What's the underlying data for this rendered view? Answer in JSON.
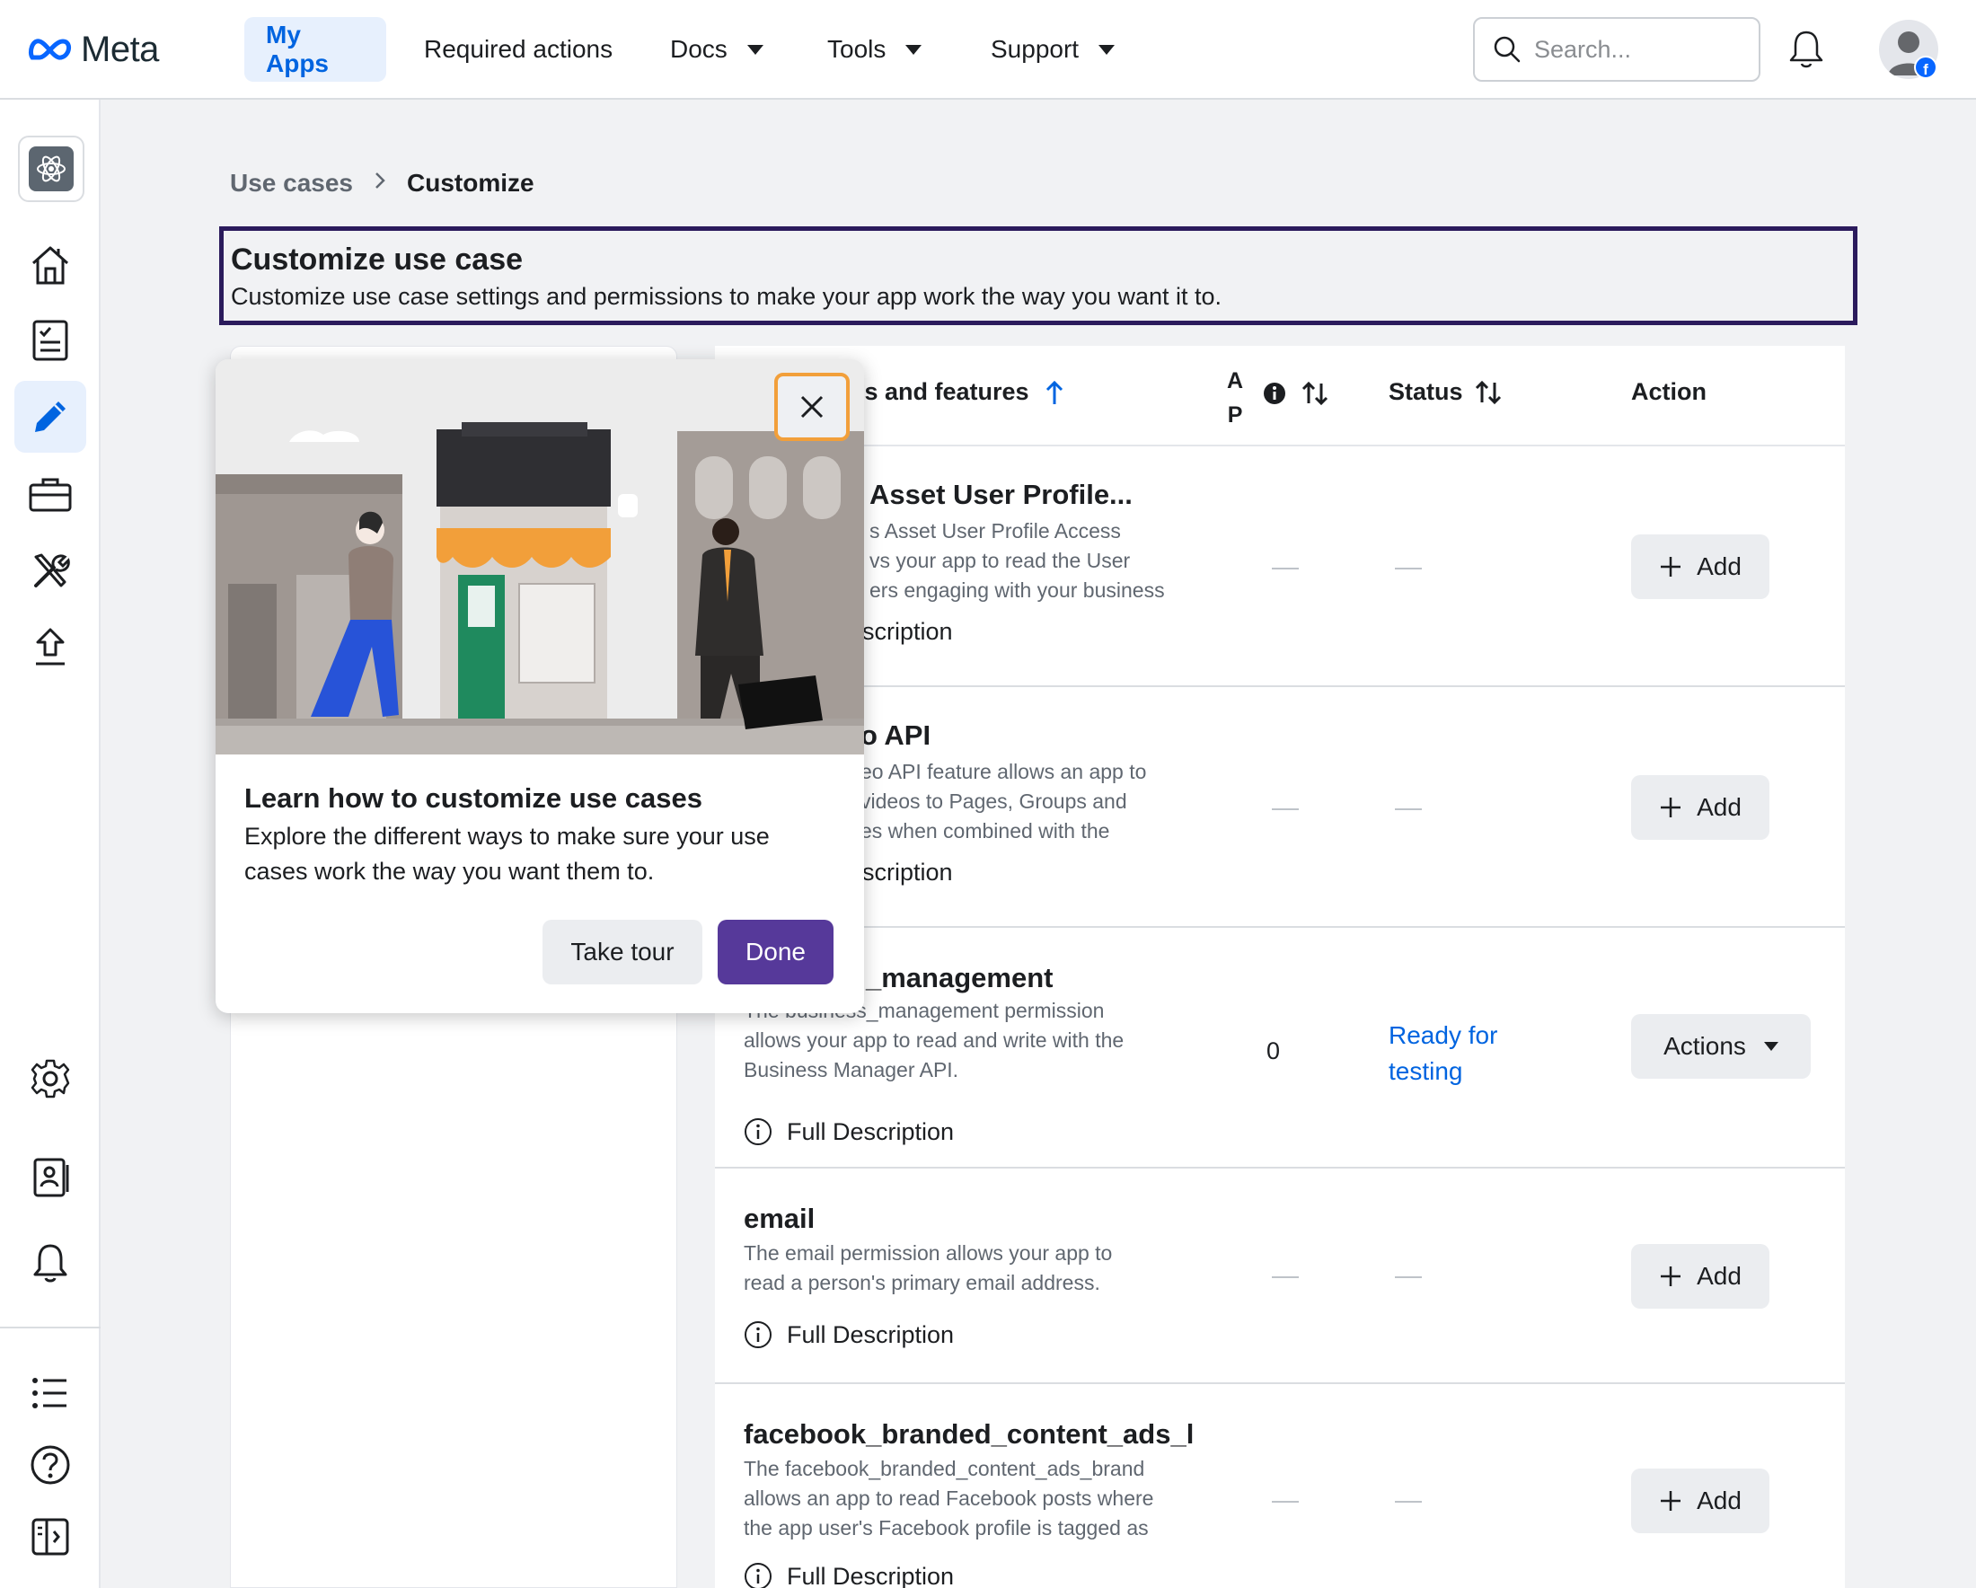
{
  "topnav": {
    "logo_text": "Meta",
    "items": [
      {
        "label": "My Apps"
      },
      {
        "label": "Required actions"
      },
      {
        "label": "Docs"
      },
      {
        "label": "Tools"
      },
      {
        "label": "Support"
      }
    ],
    "search_placeholder": "Search..."
  },
  "breadcrumb": {
    "first": "Use cases",
    "current": "Customize"
  },
  "header": {
    "title": "Customize use case",
    "subtitle": "Customize use case settings and permissions to make your app work the way you want it to."
  },
  "table": {
    "col_permissions": "ns and features",
    "col_api_a": "A",
    "col_api_p": "P",
    "col_status": "Status",
    "col_action": "Action",
    "rows": [
      {
        "name": "Asset User Profile...",
        "desc": "s Asset User Profile Access\nvs your app to read the User\ners engaging with your business",
        "full_desc": "scription",
        "add_label": "Add"
      },
      {
        "name": "o API",
        "desc": "eo API feature allows an app to\nvideos to Pages, Groups and\nes when combined with the",
        "full_desc": "scription",
        "add_label": "Add"
      },
      {
        "name": "_management",
        "desc_partial": "The business_management permission",
        "desc": "allows your app to read and write with the\nBusiness Manager API.",
        "full_desc": "Full Description",
        "count": "0",
        "status_line1": "Ready for",
        "status_line2": "testing",
        "actions_label": "Actions"
      },
      {
        "name": "email",
        "desc": "The email permission allows your app to\nread a person's primary email address.",
        "full_desc": "Full Description",
        "add_label": "Add"
      },
      {
        "name": "facebook_branded_content_ads_l",
        "desc": "The facebook_branded_content_ads_brand\nallows an app to read Facebook posts where\nthe app user's Facebook profile is tagged as",
        "full_desc": "Full Description",
        "add_label": "Add"
      }
    ]
  },
  "popover": {
    "title": "Learn how to customize use cases",
    "body": "Explore the different ways to make sure your use cases work the way you want them to.",
    "take_tour": "Take tour",
    "done": "Done"
  },
  "icons": {
    "sidebar": [
      "app-icon",
      "home-icon",
      "checklist-icon",
      "pencil-icon",
      "briefcase-icon",
      "tools-icon",
      "upload-icon",
      "gear-icon",
      "id-card-icon",
      "bell-icon",
      "list-icon",
      "help-icon",
      "panel-toggle-icon"
    ]
  },
  "colors": {
    "accent": "#0064e0",
    "primary_button": "#56399a",
    "highlight_border": "#2b1b5c",
    "close_focus": "#f29f3a"
  }
}
